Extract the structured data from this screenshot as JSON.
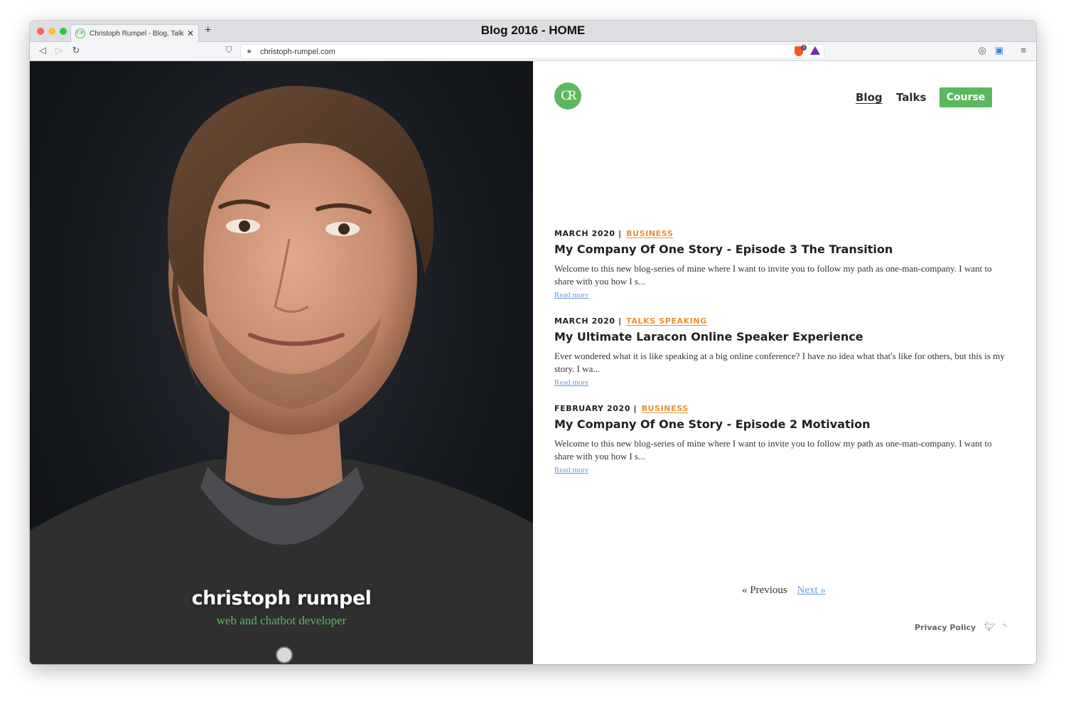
{
  "browser": {
    "window_title": "Blog 2016 - HOME",
    "tab": {
      "title": "Christoph Rumpel - Blog, Talks & More",
      "favicon": "CR"
    },
    "address": "christoph-rumpel.com"
  },
  "hero": {
    "name": "christoph rumpel",
    "tagline": "web and chatbot developer"
  },
  "site": {
    "logo": "CR",
    "nav": {
      "blog": "Blog",
      "talks": "Talks",
      "course": "Course"
    }
  },
  "posts": [
    {
      "date": "MARCH 2020",
      "separator": "|",
      "categories": "BUSINESS",
      "title": "My Company Of One Story - Episode 3 The Transition",
      "excerpt": "Welcome to this new blog-series of mine where I want to invite you to follow my path as one-man-company. I want to share with you how I s...",
      "read_more": "Read more"
    },
    {
      "date": "MARCH 2020",
      "separator": "|",
      "categories": "TALKS SPEAKING",
      "title": "My Ultimate Laracon Online Speaker Experience",
      "excerpt": "Ever wondered what it is like speaking at a big online conference? I have no idea what that's like for others, but this is my story. I wa...",
      "read_more": "Read more"
    },
    {
      "date": "FEBRUARY 2020",
      "separator": "|",
      "categories": "BUSINESS",
      "title": "My Company Of One Story - Episode 2 Motivation",
      "excerpt": "Welcome to this new blog-series of mine where I want to invite you to follow my path as one-man-company. I want to share with you how I s...",
      "read_more": "Read more"
    }
  ],
  "pagination": {
    "previous": "« Previous",
    "next": "Next »"
  },
  "footer": {
    "privacy": "Privacy Policy"
  },
  "colors": {
    "accent": "#5cb860",
    "category": "#e8922e",
    "link": "#6a9bd8"
  }
}
